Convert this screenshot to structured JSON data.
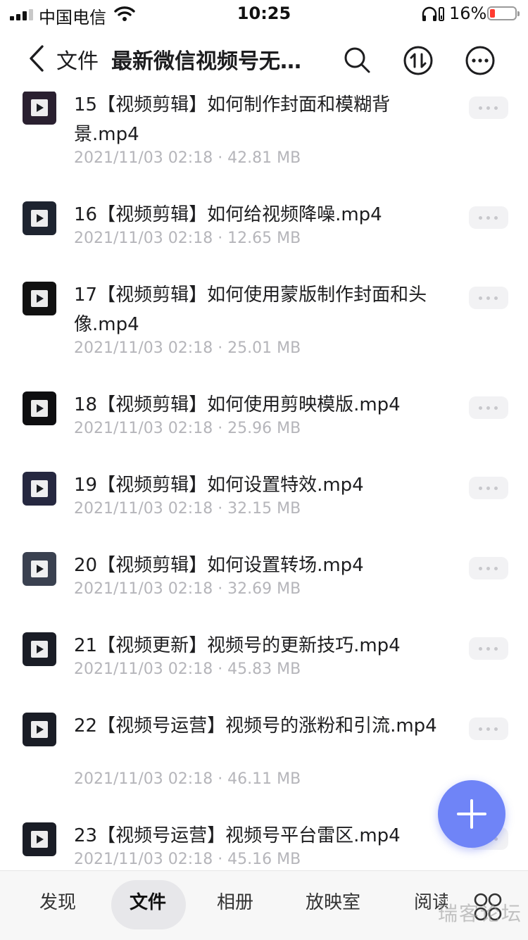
{
  "status_bar": {
    "carrier": "中国电信",
    "time": "10:25",
    "battery": "16%"
  },
  "nav": {
    "section": "文件",
    "title": "最新微信视频号无…"
  },
  "files": [
    {
      "name": "15【视频剪辑】如何制作封面和模糊背景.mp4",
      "meta": "2021/11/03 02:18 · 42.81 MB"
    },
    {
      "name": "16【视频剪辑】如何给视频降噪.mp4",
      "meta": "2021/11/03 02:18 · 12.65 MB"
    },
    {
      "name": "17【视频剪辑】如何使用蒙版制作封面和头像.mp4",
      "meta": "2021/11/03 02:18 · 25.01 MB"
    },
    {
      "name": "18【视频剪辑】如何使用剪映模版.mp4",
      "meta": "2021/11/03 02:18 · 25.96 MB"
    },
    {
      "name": "19【视频剪辑】如何设置特效.mp4",
      "meta": "2021/11/03 02:18 · 32.15 MB"
    },
    {
      "name": "20【视频剪辑】如何设置转场.mp4",
      "meta": "2021/11/03 02:18 · 32.69 MB"
    },
    {
      "name": "21【视频更新】视频号的更新技巧.mp4",
      "meta": "2021/11/03 02:18 · 45.83 MB"
    },
    {
      "name": "22【视频号运营】视频号的涨粉和引流.mp4",
      "meta": "2021/11/03 02:18 · 46.11 MB"
    },
    {
      "name": "23【视频号运营】视频号平台雷区.mp4",
      "meta": "2021/11/03 02:18 · 45.16 MB"
    }
  ],
  "tabs": [
    "发现",
    "文件",
    "相册",
    "放映室",
    "阅读"
  ],
  "watermark": "瑞客论坛"
}
